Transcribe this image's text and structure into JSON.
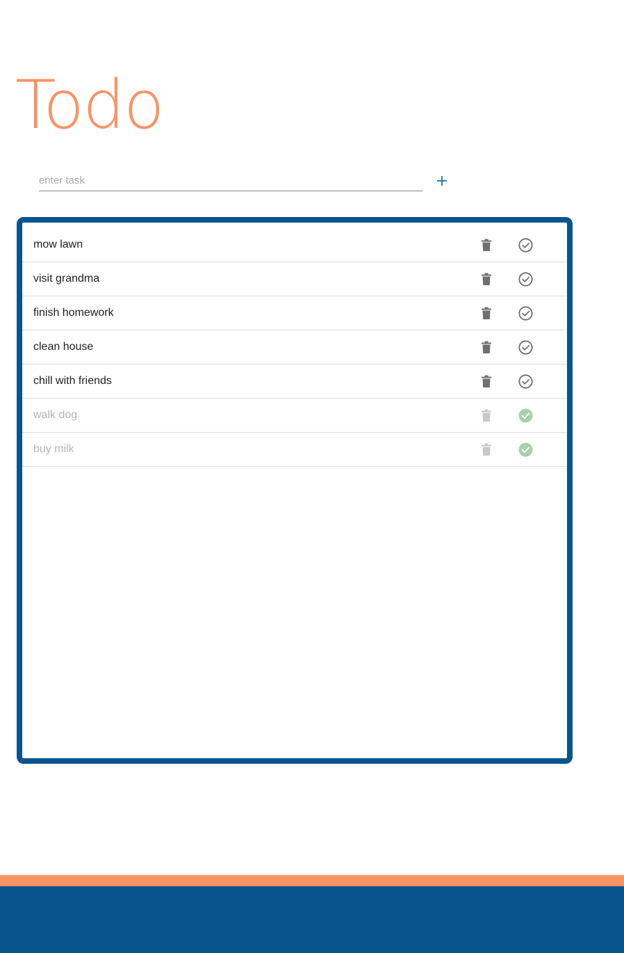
{
  "app": {
    "title": "Todo"
  },
  "input": {
    "placeholder": "enter task",
    "value": ""
  },
  "add_icon": "plus-icon",
  "colors": {
    "accent": "#fa9363",
    "primary": "#08558d",
    "done_check": "#a8d1ab",
    "icon_gray": "#6f6f6f",
    "icon_faded": "#c8c8c8"
  },
  "tasks": [
    {
      "label": "mow lawn",
      "done": false
    },
    {
      "label": "visit grandma",
      "done": false
    },
    {
      "label": "finish homework",
      "done": false
    },
    {
      "label": "clean house",
      "done": false
    },
    {
      "label": "chill with friends",
      "done": false
    },
    {
      "label": "walk dog",
      "done": true
    },
    {
      "label": "buy milk",
      "done": true
    }
  ]
}
